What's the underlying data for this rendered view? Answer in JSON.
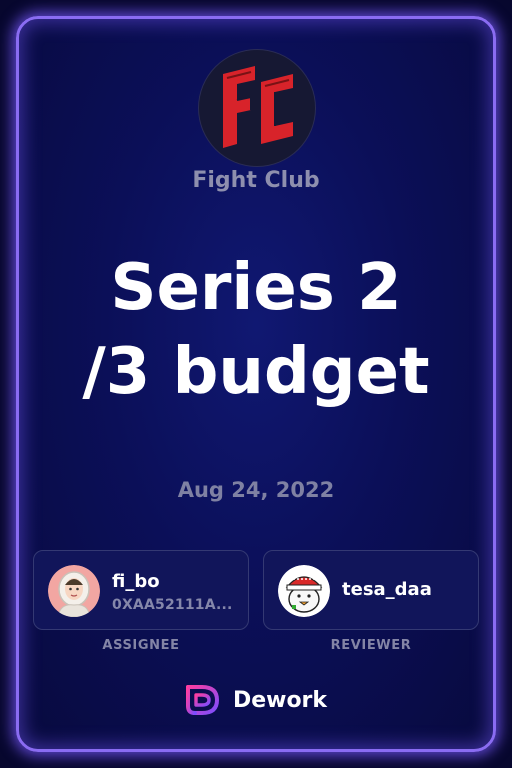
{
  "organization": {
    "name": "Fight Club",
    "logo_icon": "fight-club-logo-icon",
    "logo_color": "#d8232a"
  },
  "task": {
    "title_line1": "Series 2",
    "title_line2": "/3 budget",
    "date": "Aug 24, 2022"
  },
  "assignee": {
    "username": "fi_bo",
    "address": "0XAA52111A...",
    "role_label": "ASSIGNEE",
    "avatar_icon": "astronaut-avatar"
  },
  "reviewer": {
    "username": "tesa_daa",
    "role_label": "REVIEWER",
    "avatar_icon": "duck-with-red-hat-avatar"
  },
  "brand": {
    "name": "Dework",
    "icon": "dework-logo-icon"
  },
  "colors": {
    "card_border": "#8a6cf2",
    "card_background": "#0b0f58",
    "muted_text": "#8e8fae"
  }
}
